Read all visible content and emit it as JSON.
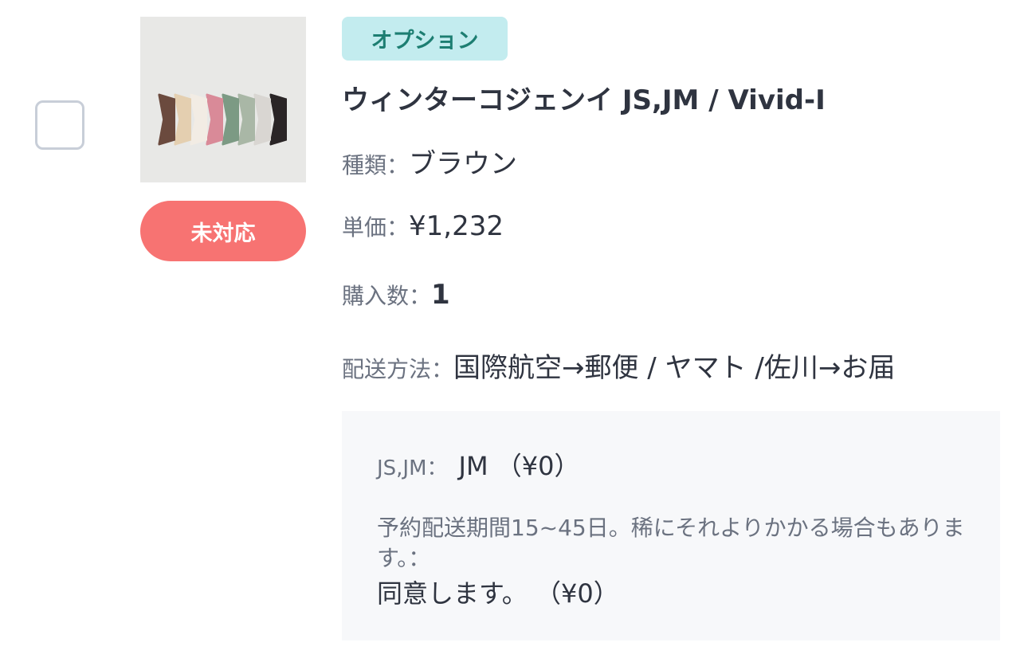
{
  "item": {
    "badge": "オプション",
    "title": "ウィンターコジェンイ JS,JM / Vivid-I",
    "status_button": "未対応",
    "fields": {
      "type_label": "種類：",
      "type_value": "ブラウン",
      "price_label": "単価：",
      "price_value": "¥1,232",
      "qty_label": "購入数：",
      "qty_value": "1",
      "shipping_label": "配送方法：",
      "shipping_value": "国際航空→郵便 / ヤマト /佐川→お届"
    },
    "options": {
      "size_label": "JS,JM：",
      "size_value": "JM （¥0）",
      "notice_label": "予約配送期間15~45日。稀にそれよりかかる場合もあります。：",
      "notice_value": "同意します。 （¥0）"
    },
    "thumbnail_colors": [
      "#6b4a3e",
      "#e4cfb0",
      "#f2ece4",
      "#d98a98",
      "#7c9a84",
      "#a9b7a6",
      "#d9d6d2",
      "#2a2526"
    ]
  }
}
